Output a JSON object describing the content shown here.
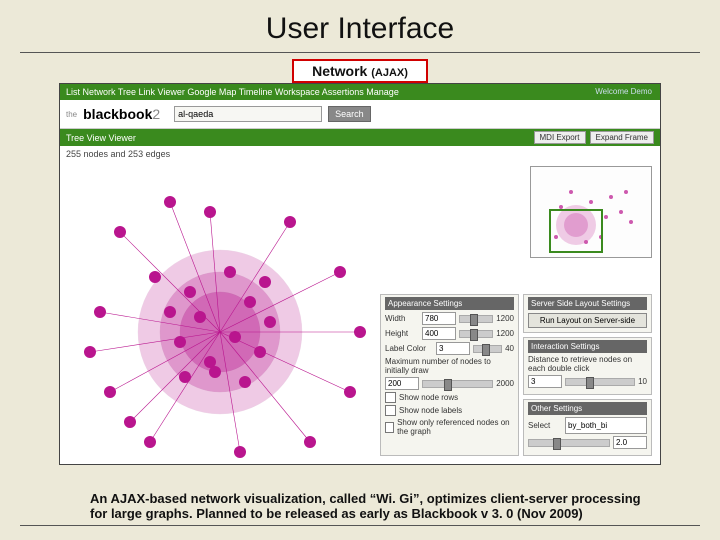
{
  "title": "User Interface",
  "tab": {
    "label": "Network",
    "suffix": "(AJAX)"
  },
  "app": {
    "menu": "List  Network  Tree  Link  Viewer  Google Map  Timeline  Workspace  Assertions  Manage",
    "welcome": "Welcome Demo",
    "brand_prefix": "the",
    "brand": "blackbook",
    "brand_suffix": "2",
    "search_value": "al-qaeda",
    "search_button": "Search",
    "viewer_title": "Tree View Viewer",
    "export_button": "MDI Export",
    "expand_button": "Expand Frame",
    "stats": "255 nodes and 253 edges"
  },
  "panels": {
    "appearance": {
      "title": "Appearance Settings",
      "width_label": "Width",
      "width_value": "780",
      "width_max": "1200",
      "height_label": "Height",
      "height_value": "400",
      "height_max": "1200",
      "label_color_label": "Label Color",
      "label_color_value": "3",
      "label_color_max": "40",
      "max_nodes_label": "Maximum number of nodes to initially draw",
      "max_nodes_value": "200",
      "max_nodes_max": "2000",
      "cb1": "Show node rows",
      "cb2": "Show node labels",
      "cb3": "Show only referenced nodes on the graph"
    },
    "layout": {
      "title": "Server Side Layout Settings",
      "run_button": "Run Layout on Server-side"
    },
    "interaction": {
      "title": "Interaction Settings",
      "distance_label": "Distance to retrieve nodes on each double click",
      "distance_value": "3",
      "distance_max": "10"
    },
    "other": {
      "title": "Other Settings",
      "select_label": "Select",
      "select_value": "by_both_bi",
      "zoom_value": "2.0"
    }
  },
  "caption": "An AJAX-based network visualization, called “Wi. Gi”, optimizes client-server processing for large graphs. Planned to be released as early as Blackbook v 3. 0 (Nov 2009)"
}
